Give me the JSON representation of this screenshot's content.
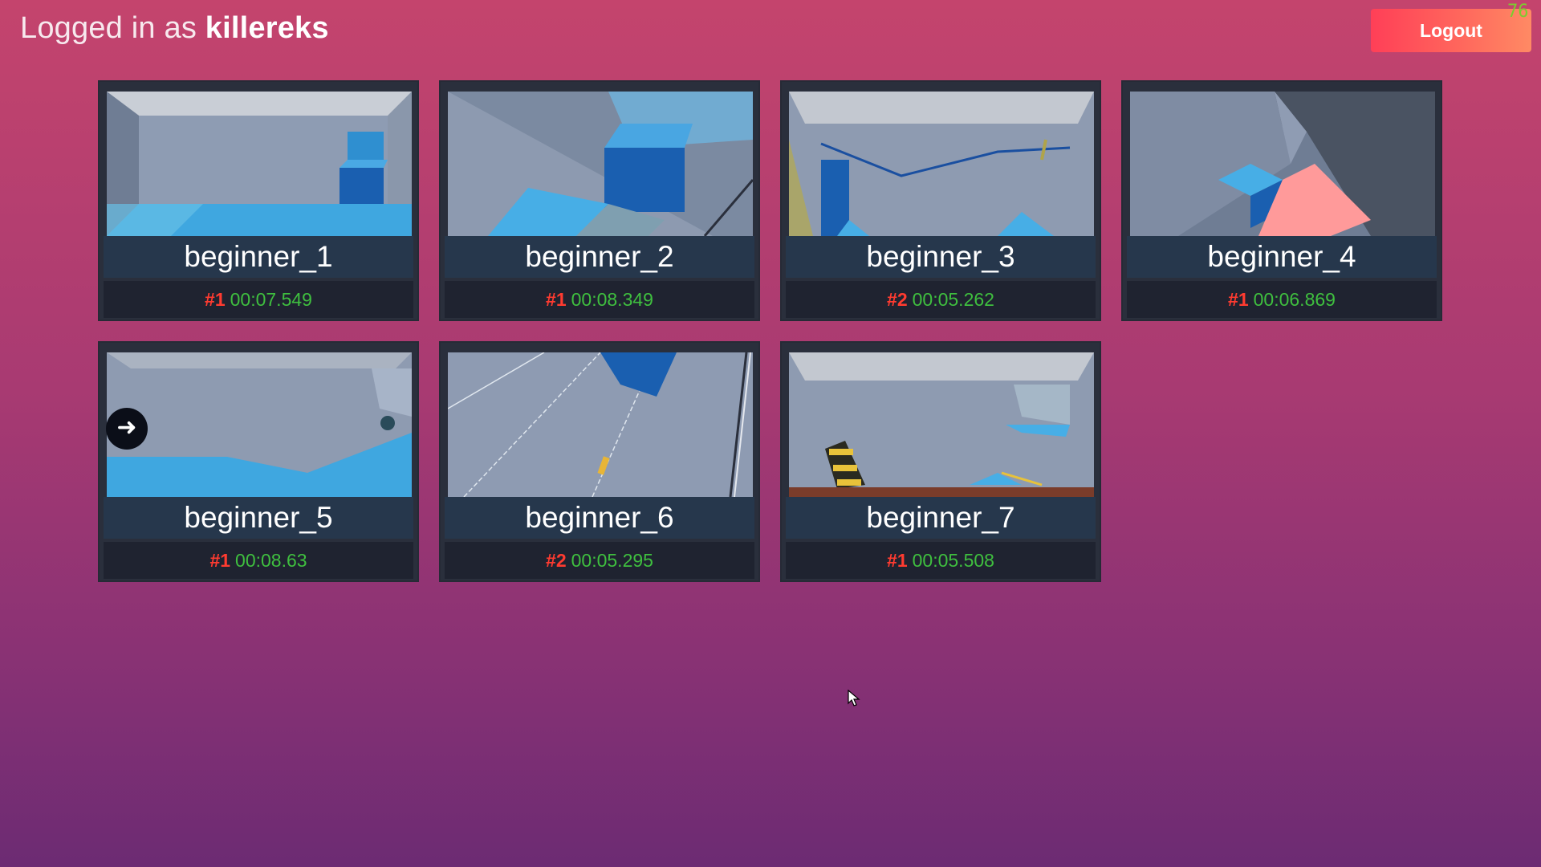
{
  "header": {
    "prefix": "Logged in as ",
    "username": "killereks",
    "logout_label": "Logout",
    "fps": "76"
  },
  "levels": [
    {
      "name": "beginner_1",
      "rank": "#1",
      "time": "00:07.549"
    },
    {
      "name": "beginner_2",
      "rank": "#1",
      "time": "00:08.349"
    },
    {
      "name": "beginner_3",
      "rank": "#2",
      "time": "00:05.262"
    },
    {
      "name": "beginner_4",
      "rank": "#1",
      "time": "00:06.869"
    },
    {
      "name": "beginner_5",
      "rank": "#1",
      "time": "00:08.63"
    },
    {
      "name": "beginner_6",
      "rank": "#2",
      "time": "00:05.295"
    },
    {
      "name": "beginner_7",
      "rank": "#1",
      "time": "00:05.508"
    }
  ],
  "icons": {
    "nav": "arrow-right-icon",
    "cursor": "mouse-cursor-icon"
  },
  "colors": {
    "rank": "#ff3b30",
    "time": "#3fbf3f",
    "logout_start": "#ff3f57",
    "logout_end": "#ff8a64"
  }
}
